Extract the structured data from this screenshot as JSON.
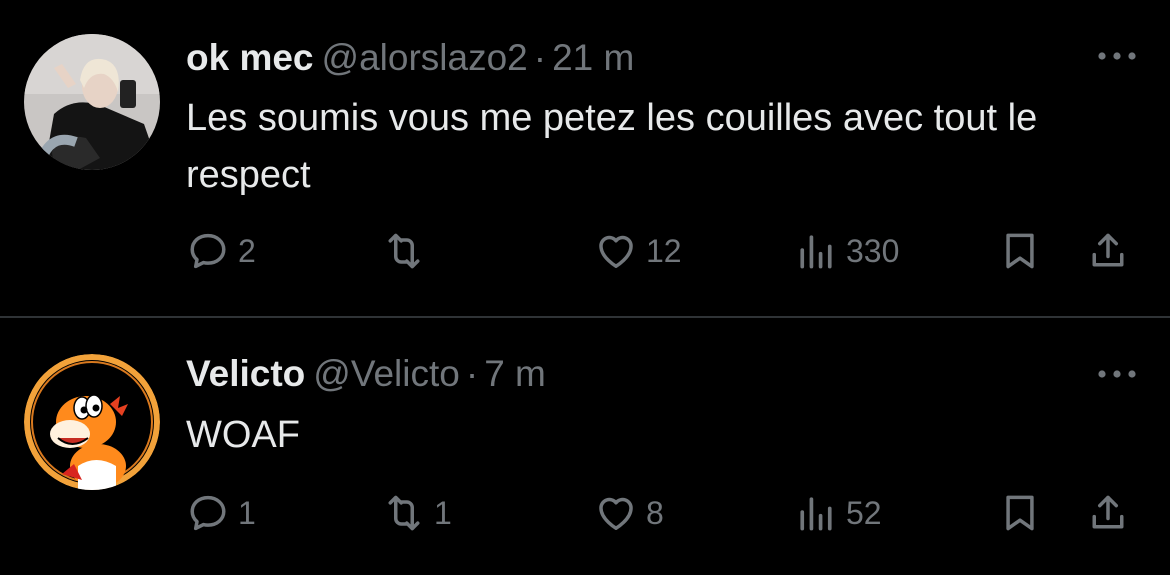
{
  "tweets": [
    {
      "name": "ok mec",
      "handle": "@alorslazo2",
      "separator": "·",
      "time": "21 m",
      "text": "Les soumis vous me petez les couilles avec tout le respect",
      "avatar_icon": "profile-photo",
      "actions": {
        "replies": "2",
        "retweets": "",
        "likes": "12",
        "views": "330"
      }
    },
    {
      "name": "Velicto",
      "handle": "@Velicto",
      "separator": "·",
      "time": "7 m",
      "text": "WOAF",
      "avatar_icon": "orange-dinosaur-avatar",
      "actions": {
        "replies": "1",
        "retweets": "1",
        "likes": "8",
        "views": "52"
      }
    }
  ],
  "colors": {
    "background": "#000000",
    "primary_text": "#e7e9ea",
    "secondary_text": "#71767b",
    "divider": "#2f3336"
  },
  "icons": [
    "reply-icon",
    "retweet-icon",
    "like-icon",
    "views-icon",
    "bookmark-icon",
    "share-icon",
    "more-icon"
  ]
}
